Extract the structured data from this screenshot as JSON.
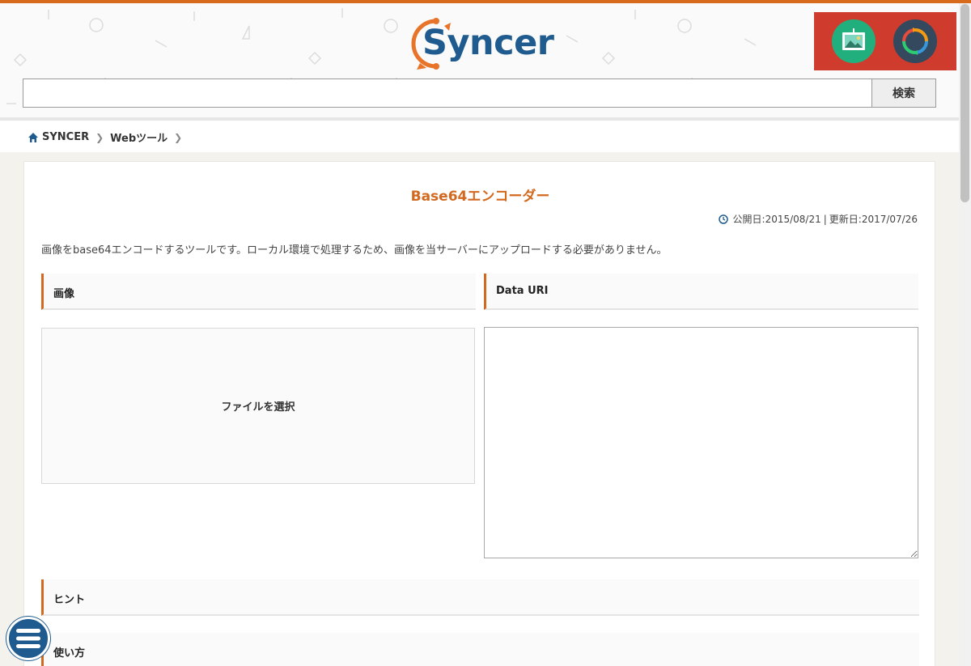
{
  "header": {
    "logo_text": "Syncer",
    "search": {
      "value": "",
      "button_label": "検索"
    },
    "apps": [
      {
        "name": "image-app",
        "icon": "picture-icon",
        "color": "#21b07d"
      },
      {
        "name": "sync-app",
        "icon": "sync-icon",
        "color": "#34495e"
      }
    ]
  },
  "breadcrumb": {
    "items": [
      {
        "label": "SYNCER",
        "icon": "home-icon"
      },
      {
        "label": "Webツール"
      }
    ]
  },
  "main": {
    "title": "Base64エンコーダー",
    "dates": {
      "published_label": "公開日:",
      "published": "2015/08/21",
      "separator": "|",
      "updated_label": "更新日:",
      "updated": "2017/07/26"
    },
    "description": "画像をbase64エンコードするツールです。ローカル環境で処理するため、画像を当サーバーにアップロードする必要がありません。",
    "sections": {
      "image": "画像",
      "data_uri": "Data URI",
      "hint": "ヒント",
      "usage": "使い方"
    },
    "dropzone_label": "ファイルを選択",
    "data_uri_value": ""
  },
  "colors": {
    "accent": "#d2691e",
    "brand_blue": "#1f5b8e",
    "top_bar": "#d86a1c",
    "apps_bg": "#cf3b2c"
  }
}
